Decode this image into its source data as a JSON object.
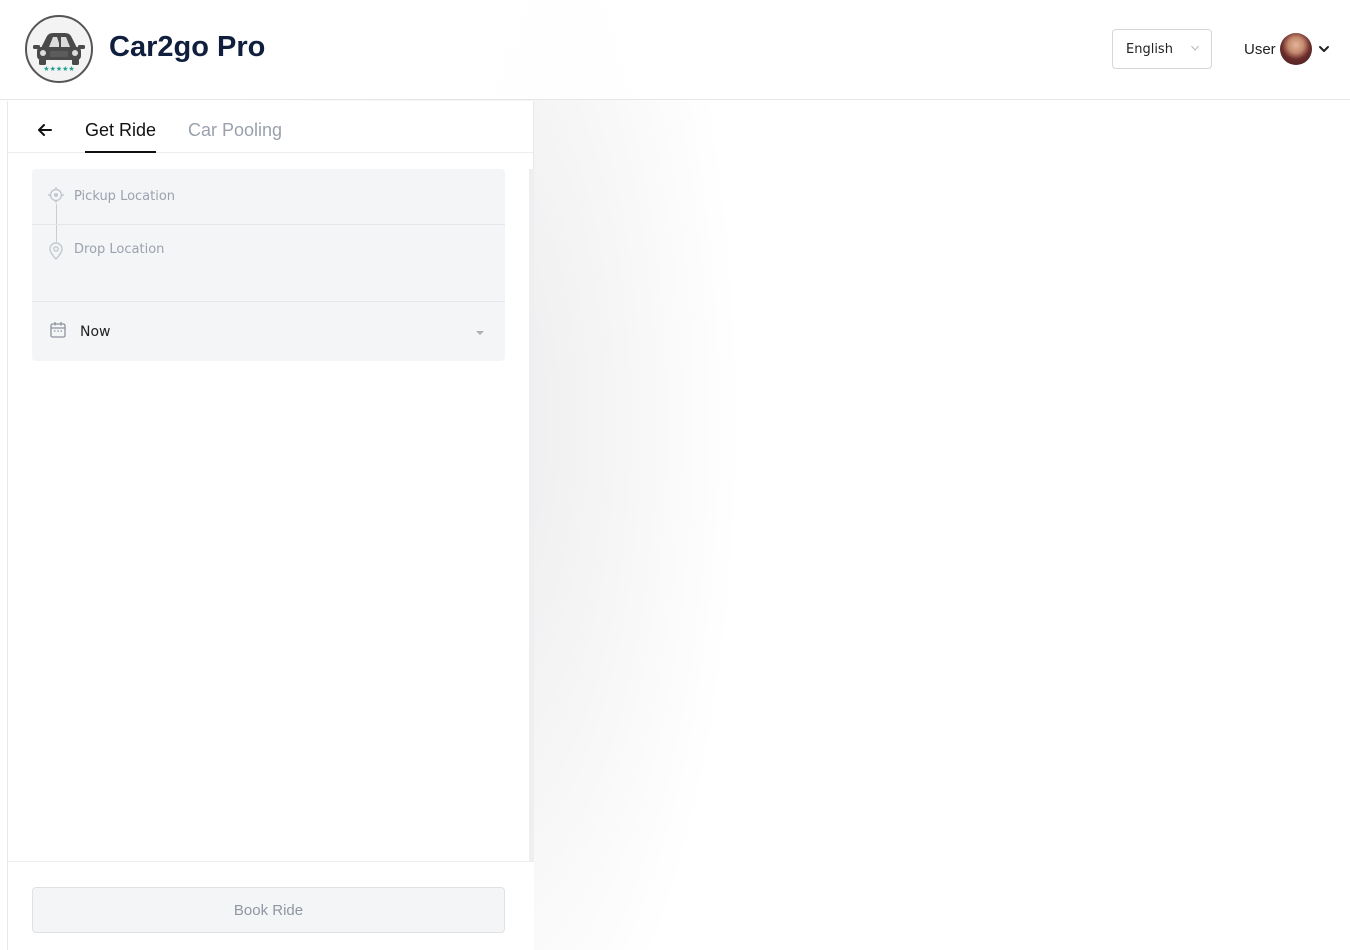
{
  "header": {
    "brand": "Car2go Pro",
    "language": {
      "selected": "English"
    },
    "user": {
      "label": "User"
    }
  },
  "panel": {
    "tabs": [
      {
        "label": "Get Ride",
        "active": true
      },
      {
        "label": "Car Pooling",
        "active": false
      }
    ],
    "pickup": {
      "placeholder": "Pickup Location"
    },
    "drop": {
      "placeholder": "Drop Location"
    },
    "schedule": {
      "selected": "Now"
    },
    "book_button": {
      "label": "Book Ride",
      "enabled": false
    }
  },
  "colors": {
    "brand_text": "#101f3d",
    "placeholder": "#9ba2ae",
    "inactive_tab": "#9aa1ad",
    "card_bg": "#f4f5f7"
  },
  "icons": {
    "back": "arrow-left-icon",
    "pickup": "target-icon",
    "drop": "map-pin-icon",
    "schedule": "calendar-icon",
    "language": "chevron-down-icon",
    "user": "chevron-down-icon"
  }
}
